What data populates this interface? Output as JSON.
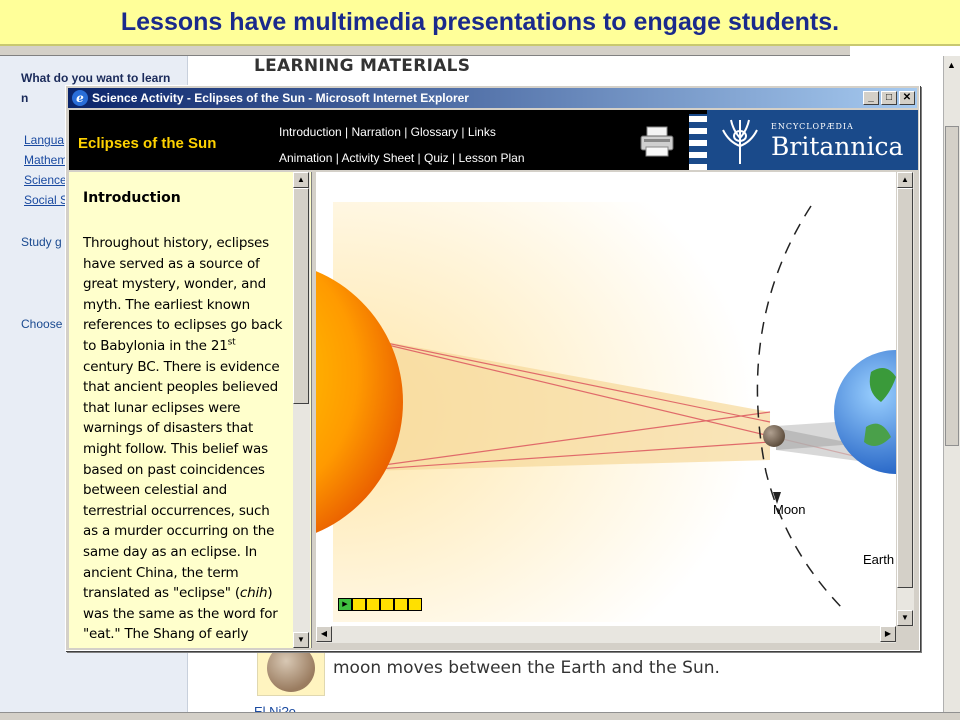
{
  "slide": {
    "heading": "Lessons have multimedia presentations to engage students."
  },
  "background_page": {
    "heading": "LEARNING MATERIALS",
    "sidebar_question": "What do you want to learn n",
    "subject_links": [
      "Langua",
      "Mathem",
      "Science",
      "Social S"
    ],
    "study_text": "Study g and exe learning",
    "choose_text": "Choose the list our Lea",
    "caption": "moon moves between the Earth and the Sun.",
    "bottom_link": "El Ni?o"
  },
  "window": {
    "title": "Science Activity - Eclipses of the Sun - Microsoft Internet Explorer",
    "controls": {
      "minimize": "_",
      "maximize": "□",
      "close": "✕"
    }
  },
  "header": {
    "section_title": "Eclipses of the Sun",
    "nav_row1": [
      "Introduction",
      "Narration",
      "Glossary",
      "Links"
    ],
    "nav_row2": [
      "Animation",
      "Activity Sheet",
      "Quiz",
      "Lesson Plan"
    ],
    "separator": " | ",
    "brand_small": "ENCYCLOPÆDIA",
    "brand_name": "Britannica",
    "icons": [
      "printer-icon",
      "thistle-logo-icon"
    ]
  },
  "intro": {
    "heading": "Introduction",
    "text_before_sup": "Throughout history, eclipses have served as a source of great mystery, wonder, and myth. The earliest known references to eclipses go back to Babylonia in the 21",
    "sup": "st",
    "text_after_sup": " century BC. There is evidence that ancient peoples believed that lunar eclipses were warnings of disasters that might follow. This belief was based on past coincidences between celestial and terrestrial occurrences, such as a murder occurring on the same day as an eclipse. In ancient China, the term translated as \"eclipse\" (",
    "italic_word": "chih",
    "text_end": ") was the same as the word for \"eat.\" The Shang of early"
  },
  "animation": {
    "labels": {
      "moon": "Moon",
      "earth": "Earth"
    },
    "progress": {
      "total_frames": 5,
      "play_symbol": "▶"
    }
  },
  "colors": {
    "banner_bg": "#ffff99",
    "banner_text": "#1a2a8c",
    "header_bg": "#000000",
    "section_title": "#ffd200",
    "intro_bg": "#ffffcc",
    "brand_blue": "#1a4a8a"
  }
}
